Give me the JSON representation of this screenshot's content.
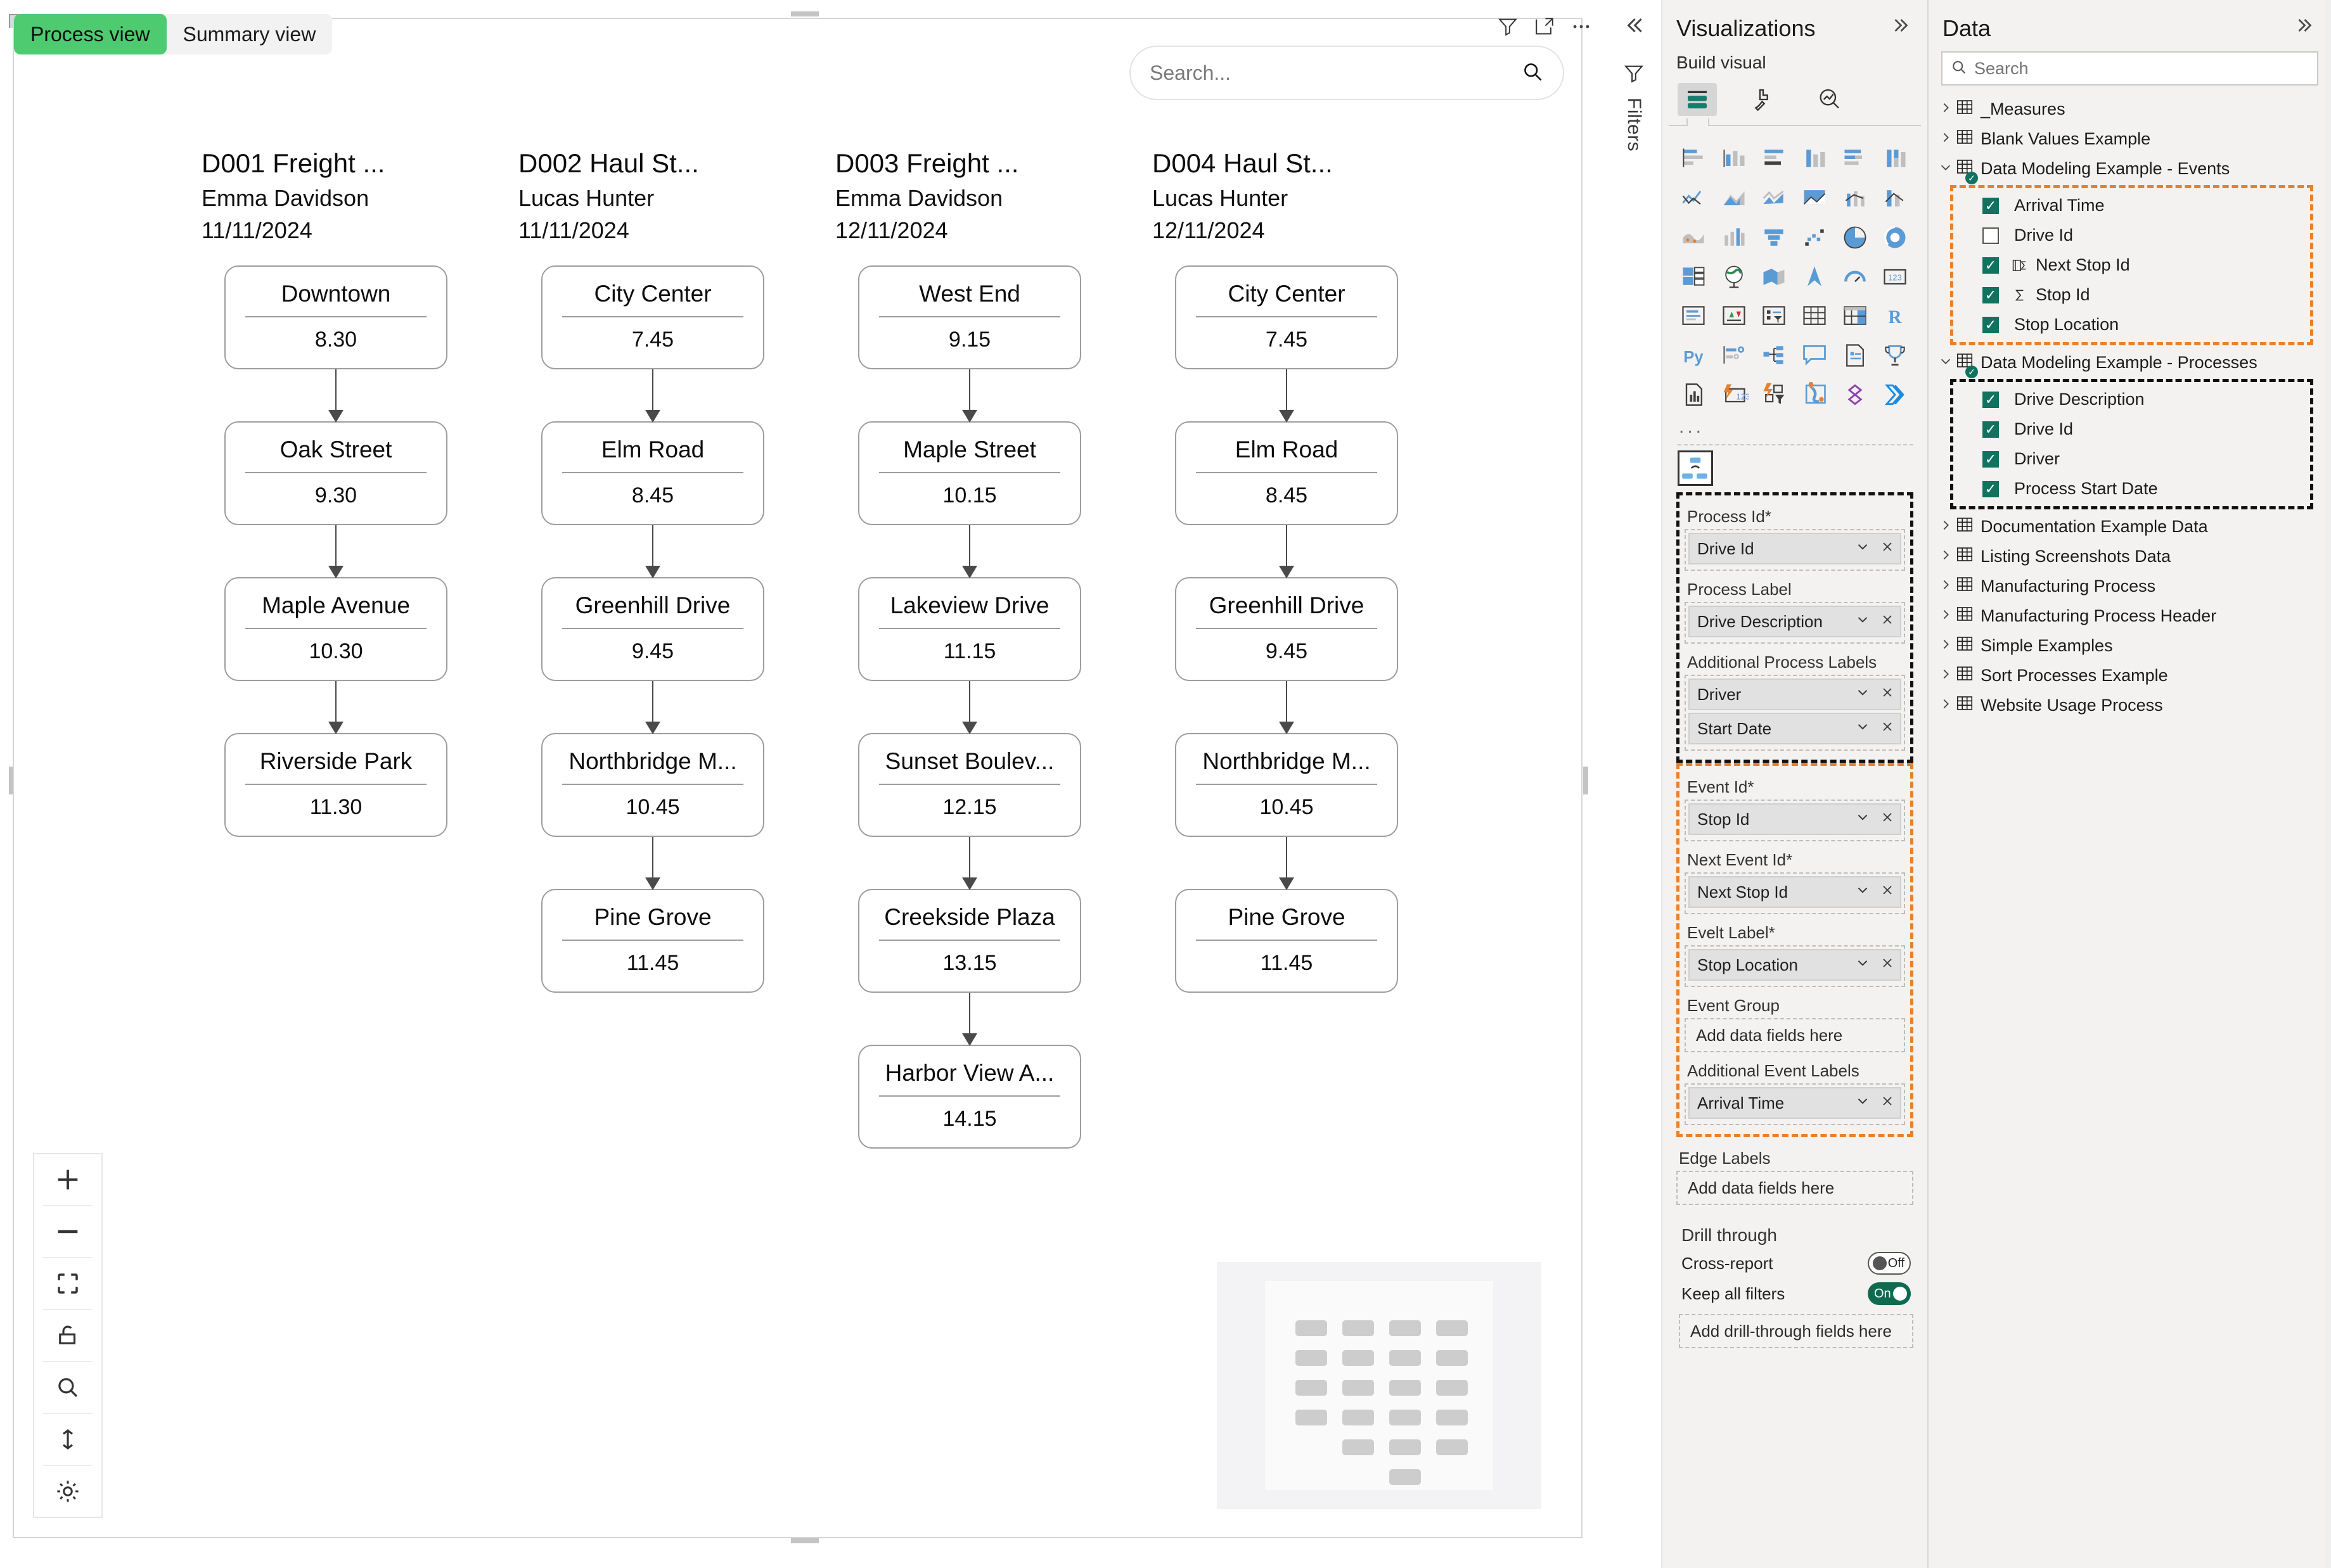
{
  "canvas": {
    "tabs": [
      {
        "label": "Process view",
        "active": true
      },
      {
        "label": "Summary view",
        "active": false
      }
    ],
    "header_icons": [
      "filter-icon",
      "focus-mode-icon",
      "more-options-icon"
    ],
    "search": {
      "placeholder": "Search...",
      "value": "",
      "icon": "search-icon"
    },
    "zoom_toolbar": [
      "zoom-in-icon",
      "zoom-out-icon",
      "fit-to-screen-icon",
      "lock-icon",
      "search-icon",
      "fit-height-icon",
      "brightness-icon"
    ],
    "watermark": "placeholder-grid-logo"
  },
  "chart_data": {
    "type": "diagram",
    "title": "Process view",
    "processes": [
      {
        "title": "D001 Freight ...",
        "driver": "Emma Davidson",
        "start_date": "11/11/2024",
        "events": [
          {
            "label": "Downtown",
            "value": "8.30"
          },
          {
            "label": "Oak Street",
            "value": "9.30"
          },
          {
            "label": "Maple Avenue",
            "value": "10.30"
          },
          {
            "label": "Riverside Park",
            "value": "11.30"
          }
        ]
      },
      {
        "title": "D002 Haul St...",
        "driver": "Lucas Hunter",
        "start_date": "11/11/2024",
        "events": [
          {
            "label": "City Center",
            "value": "7.45"
          },
          {
            "label": "Elm Road",
            "value": "8.45"
          },
          {
            "label": "Greenhill Drive",
            "value": "9.45"
          },
          {
            "label": "Northbridge M...",
            "value": "10.45"
          },
          {
            "label": "Pine Grove",
            "value": "11.45"
          }
        ]
      },
      {
        "title": "D003 Freight ...",
        "driver": "Emma Davidson",
        "start_date": "12/11/2024",
        "events": [
          {
            "label": "West End",
            "value": "9.15"
          },
          {
            "label": "Maple Street",
            "value": "10.15"
          },
          {
            "label": "Lakeview Drive",
            "value": "11.15"
          },
          {
            "label": "Sunset Boulev...",
            "value": "12.15"
          },
          {
            "label": "Creekside Plaza",
            "value": "13.15"
          },
          {
            "label": "Harbor View A...",
            "value": "14.15"
          }
        ]
      },
      {
        "title": "D004 Haul St...",
        "driver": "Lucas Hunter",
        "start_date": "12/11/2024",
        "events": [
          {
            "label": "City Center",
            "value": "7.45"
          },
          {
            "label": "Elm Road",
            "value": "8.45"
          },
          {
            "label": "Greenhill Drive",
            "value": "9.45"
          },
          {
            "label": "Northbridge M...",
            "value": "10.45"
          },
          {
            "label": "Pine Grove",
            "value": "11.45"
          }
        ]
      }
    ]
  },
  "filters_rail": {
    "label": "Filters",
    "collapse_icon": "chevron-double-left-icon",
    "funnel_icon": "filter-icon"
  },
  "visualizations": {
    "title": "Visualizations",
    "collapse_icon": "chevron-double-right-icon",
    "build_visual_label": "Build visual",
    "build_tabs": [
      {
        "name": "fields-tab",
        "selected": true
      },
      {
        "name": "format-tab",
        "selected": false
      },
      {
        "name": "analytics-tab",
        "selected": false
      }
    ],
    "gallery_more": "...",
    "wells": [
      {
        "group": "process",
        "outline": "black",
        "items": [
          {
            "label": "Process Id*",
            "chips": [
              "Drive Id"
            ],
            "dashed_slot": true
          },
          {
            "label": "Process Label",
            "chips": [
              "Drive Description"
            ],
            "dashed_slot": true
          },
          {
            "label": "Additional Process Labels",
            "chips": [
              "Driver",
              "Start Date"
            ],
            "dashed_slot": true
          }
        ]
      },
      {
        "group": "event",
        "outline": "orange",
        "items": [
          {
            "label": "Event Id*",
            "chips": [
              "Stop Id"
            ],
            "dashed_slot": true
          },
          {
            "label": "Next Event Id*",
            "chips": [
              "Next Stop Id"
            ],
            "dashed_slot": true
          },
          {
            "label": "Evelt Label*",
            "chips": [
              "Stop Location"
            ],
            "dashed_slot": true
          },
          {
            "label": "Event Group",
            "chips": [],
            "empty_text": "Add data fields here"
          },
          {
            "label": "Additional Event Labels",
            "chips": [
              "Arrival Time"
            ],
            "dashed_slot": true
          }
        ]
      },
      {
        "group": "edge",
        "outline": "none",
        "items": [
          {
            "label": "Edge Labels",
            "chips": [],
            "empty_text": "Add data fields here"
          }
        ]
      }
    ],
    "drill_through": {
      "title": "Drill through",
      "cross_report": {
        "label": "Cross-report",
        "state": "Off",
        "on": false
      },
      "keep_all_filters": {
        "label": "Keep all filters",
        "state": "On",
        "on": true
      },
      "placeholder": "Add drill-through fields here"
    }
  },
  "data_pane": {
    "title": "Data",
    "collapse_icon": "chevron-double-right-icon",
    "search": {
      "placeholder": "Search",
      "value": "",
      "icon": "search-icon"
    },
    "tables": [
      {
        "name": "_Measures",
        "expanded": false,
        "checked": false,
        "fields": []
      },
      {
        "name": "Blank Values Example",
        "expanded": false,
        "checked": false,
        "fields": []
      },
      {
        "name": "Data Modeling Example - Events",
        "expanded": true,
        "checked": true,
        "outline": "orange",
        "fields": [
          {
            "name": "Arrival Time",
            "checked": true,
            "icon": ""
          },
          {
            "name": "Drive Id",
            "checked": false,
            "icon": ""
          },
          {
            "name": "Next Stop Id",
            "checked": true,
            "icon": "measure-group-icon"
          },
          {
            "name": "Stop Id",
            "checked": true,
            "icon": "sigma-icon"
          },
          {
            "name": "Stop Location",
            "checked": true,
            "icon": ""
          }
        ]
      },
      {
        "name": "Data Modeling Example - Processes",
        "expanded": true,
        "checked": true,
        "outline": "black",
        "fields": [
          {
            "name": "Drive Description",
            "checked": true,
            "icon": ""
          },
          {
            "name": "Drive Id",
            "checked": true,
            "icon": ""
          },
          {
            "name": "Driver",
            "checked": true,
            "icon": ""
          },
          {
            "name": "Process Start Date",
            "checked": true,
            "icon": ""
          }
        ]
      },
      {
        "name": "Documentation Example Data",
        "expanded": false,
        "checked": false,
        "fields": []
      },
      {
        "name": "Listing Screenshots Data",
        "expanded": false,
        "checked": false,
        "fields": []
      },
      {
        "name": "Manufacturing Process",
        "expanded": false,
        "checked": false,
        "fields": []
      },
      {
        "name": "Manufacturing Process Header",
        "expanded": false,
        "checked": false,
        "fields": []
      },
      {
        "name": "Simple Examples",
        "expanded": false,
        "checked": false,
        "fields": []
      },
      {
        "name": "Sort Processes Example",
        "expanded": false,
        "checked": false,
        "fields": []
      },
      {
        "name": "Website Usage Process",
        "expanded": false,
        "checked": false,
        "fields": []
      }
    ]
  },
  "colors": {
    "accent_green": "#4ecb71",
    "toggle_on": "#0f6b4f",
    "checkbox_on": "#0f7360",
    "outline_orange": "#E8812B",
    "outline_black": "#111111",
    "panel_bg": "#f3f2f1"
  }
}
